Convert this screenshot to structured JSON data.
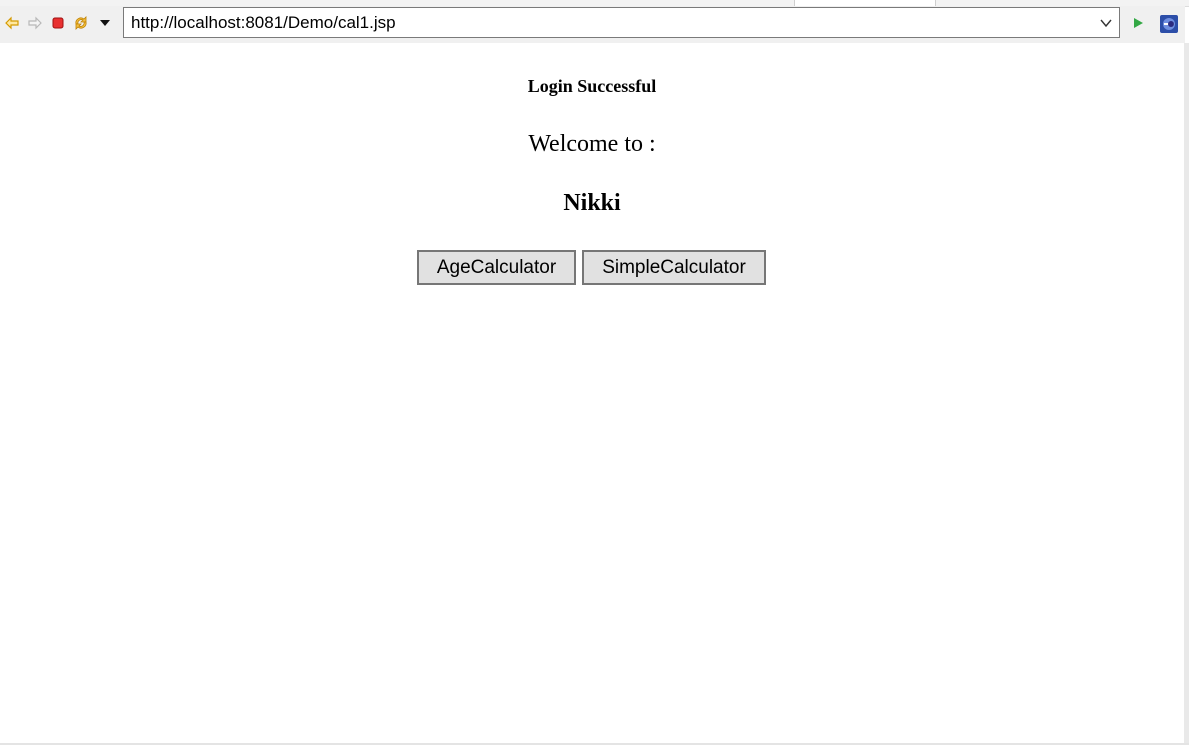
{
  "browser": {
    "url": "http://localhost:8081/Demo/cal1.jsp",
    "icons": {
      "back": "back-arrow-icon",
      "forward": "forward-arrow-icon",
      "stop": "stop-icon",
      "refresh": "refresh-icon",
      "menu": "dropdown-triangle-icon",
      "go": "go-play-icon",
      "extra": "eclipse-icon"
    },
    "colors": {
      "back_arrow": "#e0a000",
      "stop": "#e02020",
      "go": "#2a9a3a",
      "extra_icon": "#2a4aa0"
    }
  },
  "page": {
    "login_message": "Login Successful",
    "welcome_text": "Welcome to :",
    "username": "Nikki",
    "buttons": {
      "age_calculator": "AgeCalculator",
      "simple_calculator": "SimpleCalculator"
    }
  }
}
